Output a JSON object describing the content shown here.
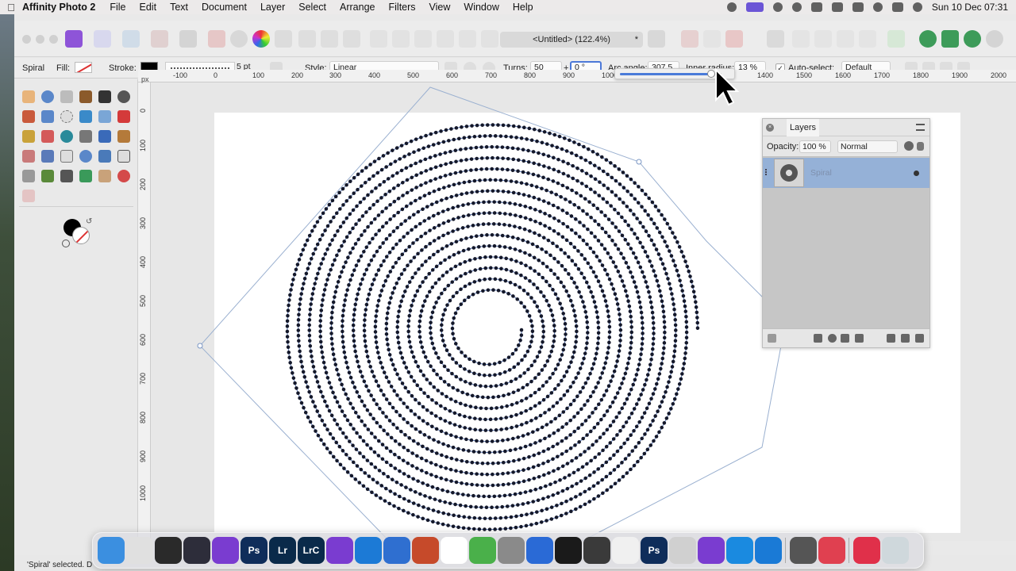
{
  "menubar": {
    "app_name": "Affinity Photo 2",
    "items": [
      "File",
      "Edit",
      "Text",
      "Document",
      "Layer",
      "Select",
      "Arrange",
      "Filters",
      "View",
      "Window",
      "Help"
    ],
    "clock": "Sun 10 Dec  07:31"
  },
  "toolbar": {
    "document_title": "<Untitled> (122.4%)",
    "modified_marker": "*"
  },
  "context": {
    "tool_name": "Spiral",
    "fill_label": "Fill:",
    "stroke_label": "Stroke:",
    "stroke_width": "5 pt",
    "style_label": "Style:",
    "style_value": "Linear",
    "turns_label": "Turns:",
    "turns_value": "50",
    "plus": "+",
    "rotation_value": "0 °",
    "arc_angle_label": "Arc angle:",
    "arc_angle_value": "307.5",
    "inner_radius_label": "Inner radius:",
    "inner_radius_value": "13 %",
    "auto_select_label": "Auto-select:",
    "auto_select_value": "Default",
    "inner_radius_slider_fraction": 0.13
  },
  "ruler": {
    "unit": "px",
    "top_ticks": [
      "-100",
      "0",
      "100",
      "200",
      "300",
      "400",
      "500",
      "600",
      "700",
      "800",
      "900",
      "1000",
      "1400",
      "1500",
      "1600",
      "1700",
      "1800",
      "1900",
      "2000"
    ],
    "left_ticks": [
      "0",
      "100",
      "200",
      "300",
      "400",
      "500",
      "600",
      "700",
      "800",
      "900",
      "1000"
    ]
  },
  "layers": {
    "tab_label": "Layers",
    "opacity_label": "Opacity:",
    "opacity_value": "100 %",
    "blend_mode": "Normal",
    "layer_name": "Spiral"
  },
  "status": {
    "text": "'Spiral' selected. D"
  },
  "dock": {
    "items": [
      "Finder",
      "Launchpad",
      "Chrome",
      "DaVinci Resolve",
      "Affinity Publisher",
      "Photoshop",
      "Lightroom",
      "Lightroom Classic",
      "Affinity Photo",
      "Affinity Designer",
      "Affinity Designer 2",
      "Threads",
      "Numbers",
      "System Settings",
      "Pixelmator",
      "Ink",
      "Affinity Photo Beta",
      "Photos",
      "Photoshop Beta",
      "Preview",
      "Affinity Designer Beta",
      "Edge",
      "Safari",
      "QuickTime",
      "News",
      "Creative Cloud",
      "Downloads",
      "Trash"
    ],
    "ps_label": "Ps",
    "lr_label": "Lr",
    "lrc_label": "LrC"
  },
  "colors": {
    "accent": "#4c79d8",
    "spiral_dot": "#14182a",
    "spiral_line": "#5a78b8",
    "selected_layer": "#95b1d7"
  }
}
